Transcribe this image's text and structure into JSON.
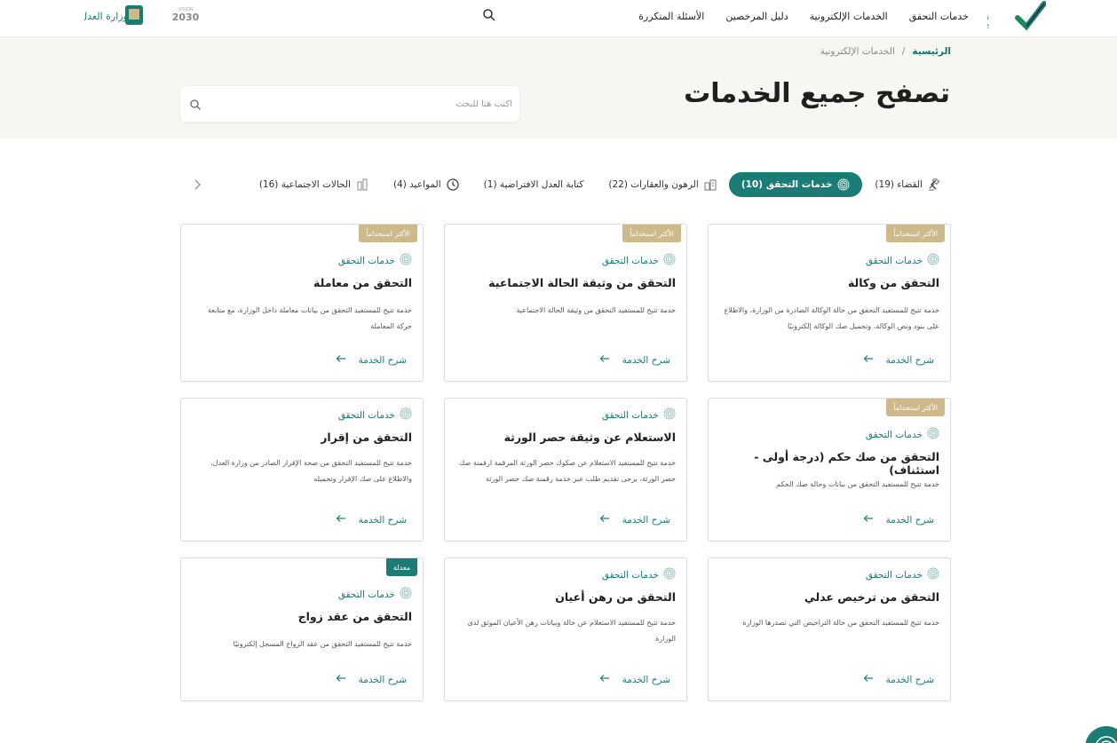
{
  "header": {
    "logo_text": "ناجز najiz",
    "nav": [
      {
        "label": "خدمات التحقق"
      },
      {
        "label": "الخدمات الإلكترونية"
      },
      {
        "label": "دليل المرخصين"
      },
      {
        "label": "الأسئلة المتكررة"
      }
    ],
    "vision_text": "VISION 2030",
    "moj_text": "وزارة العدل"
  },
  "hero": {
    "breadcrumb_home": "الرئيسية",
    "breadcrumb_sep": "/",
    "breadcrumb_current": "الخدمات الإلكترونية",
    "title": "تصفح جميع الخدمات",
    "search_placeholder": "اكتب هنا للبحث"
  },
  "tabs": [
    {
      "label": "القضاء (19)",
      "icon": "gavel-icon",
      "active": false
    },
    {
      "label": "خدمات التحقق (10)",
      "icon": "fingerprint-icon",
      "active": true
    },
    {
      "label": "الرهون والعقارات (22)",
      "icon": "buildings-icon",
      "active": false
    },
    {
      "label": "كتابة العدل الافتراضية (1)",
      "icon": "",
      "active": false
    },
    {
      "label": "المواعيد (4)",
      "icon": "clock-icon",
      "active": false
    },
    {
      "label": "الحالات الاجتماعية (16)",
      "icon": "family-icon",
      "active": false
    }
  ],
  "cards": [
    {
      "badge": "الأكثر استخداماً",
      "badge_color": "gold",
      "category": "خدمات التحقق",
      "title": "التحقق من وكالة",
      "description": "خدمة تتيح للمستفيد التحقق من حالة الوكالة الصادرة من الوزارة، والاطلاع على بنود ونص الوكالة، وتحميل صك الوكالة إلكترونيًا",
      "link": "شرح الخدمة"
    },
    {
      "badge": "الأكثر استخداماً",
      "badge_color": "gold",
      "category": "خدمات التحقق",
      "title": "التحقق من وثيقة الحالة الاجتماعية",
      "description": "خدمة تتيح للمستفيد التحقق من وثيقة الحالة الاجتماعية",
      "link": "شرح الخدمة"
    },
    {
      "badge": "الأكثر استخداماً",
      "badge_color": "gold",
      "category": "خدمات التحقق",
      "title": "التحقق من معاملة",
      "description": "خدمة تتيح للمستفيد التحقق من بيانات معاملة داخل الوزارة، مع متابعة حركة المعاملة",
      "link": "شرح الخدمة"
    },
    {
      "badge": "الأكثر استخداماً",
      "badge_color": "gold",
      "category": "خدمات التحقق",
      "title": "التحقق من صك حكم (درجة أولى - استئناف)",
      "description": "خدمة تتيح للمستفيد التحقق من بيانات وحالة صك الحكم",
      "link": "شرح الخدمة"
    },
    {
      "badge": "",
      "category": "خدمات التحقق",
      "title": "الاستعلام عن وثيقة حصر الورثة",
      "description": "خدمة تتيح للمستفيد الاستعلام عن صكوك حصر الورثة المرقمة ارقمنة صك حصر الورثة، يرجى تقديم طلب عبر خدمة رقمنة صك حصر الورثة",
      "link": "شرح الخدمة"
    },
    {
      "badge": "",
      "category": "خدمات التحقق",
      "title": "التحقق من إقرار",
      "description": "خدمة تتيح للمستفيد التحقق من صحة الإقرار الصادر من وزارة العدل، والاطلاع على صك الإقرار وتحميله",
      "link": "شرح الخدمة"
    },
    {
      "badge": "",
      "category": "خدمات التحقق",
      "title": "التحقق من ترخيص عدلي",
      "description": "خدمة تتيح للمستفيد التحقق من حالة التراخيص التي تصدرها الوزارة",
      "link": "شرح الخدمة"
    },
    {
      "badge": "",
      "category": "خدمات التحقق",
      "title": "التحقق من رهن أعيان",
      "description": "خدمة تتيح للمستفيد الاستعلام عن حالة وبيانات رهن الأعيان الموثق لدى الوزارة",
      "link": "شرح الخدمة"
    },
    {
      "badge": "معدلة",
      "badge_color": "teal",
      "category": "خدمات التحقق",
      "title": "التحقق من عقد زواج",
      "description": "خدمة تتيح للمستفيد التحقق من عقد الزواج المسجل إلكترونيًا",
      "link": "شرح الخدمة"
    }
  ],
  "colors": {
    "primary": "#1b7b75",
    "badge_gold": "#cdb98a",
    "hero_bg": "#f7f6f2"
  }
}
